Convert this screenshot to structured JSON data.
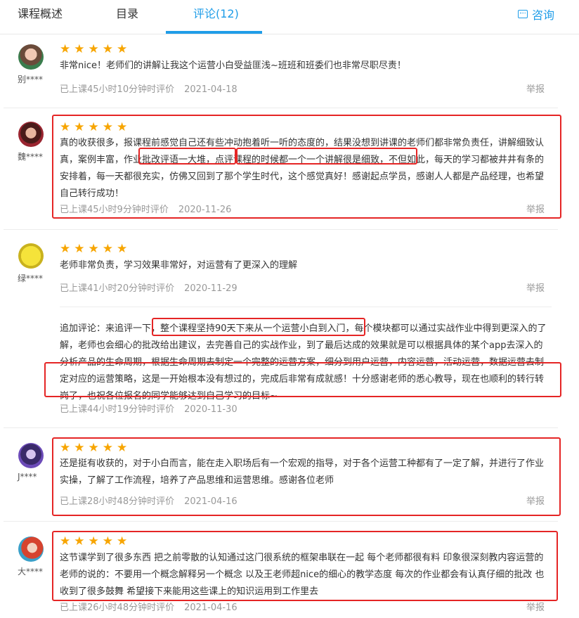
{
  "tabs": [
    {
      "label": "课程概述"
    },
    {
      "label": "目录"
    },
    {
      "label": "评论(12)"
    }
  ],
  "consult": "咨询",
  "report_label": "举报",
  "reviews": [
    {
      "user": "别****",
      "stars": "★★★★★",
      "text": "非常nice！老师们的讲解让我这个运营小白受益匪浅~班班和班委们也非常尽职尽责！",
      "attended": "已上课45小时10分钟时评价",
      "date": "2021-04-18"
    },
    {
      "user": "魏****",
      "stars": "★★★★★",
      "text": "真的收获很多，报课程前感觉自己还有些冲动抱着听一听的态度的，结果没想到讲课的老师们都非常负责任，讲解细致认真，案例丰富，作业批改评语一大堆，点评课程的时候都一个一个讲解很是细致，不但如此，每天的学习都被井井有条的安排着，每一天都很充实，仿佛又回到了那个学生时代，这个感觉真好！感谢起点学员，感谢人人都是产品经理，也希望自己转行成功！",
      "attended": "已上课45小时9分钟时评价",
      "date": "2020-11-26"
    },
    {
      "user": "绿****",
      "stars": "★★★★★",
      "text": "老师非常负责，学习效果非常好，对运营有了更深入的理解",
      "attended": "已上课41小时20分钟时评价",
      "date": "2020-11-29",
      "followup": "追加评论：来追评一下，整个课程坚持90天下来从一个运营小白到入门，每个模块都可以通过实战作业中得到更深入的了解，老师也会细心的批改给出建议，去完善自己的实战作业，到了最后达成的效果就是可以根据具体的某个app去深入的分析产品的生命周期，根据生命周期去制定一个完整的运营方案，细分到用户运营，内容运营，活动运营，数据运营去制定对应的运营策略，这是一开始根本没有想过的，完成后非常有成就感！十分感谢老师的悉心教导，现在也顺利的转行转岗了，也祝各位报名的同学能够达到自己学习的目标~",
      "followup_attended": "已上课44小时19分钟时评价",
      "followup_date": "2020-11-30"
    },
    {
      "user": "J****",
      "stars": "★★★★★",
      "text": "还是挺有收获的，对于小白而言，能在走入职场后有一个宏观的指导，对于各个运营工种都有了一定了解，并进行了作业实操，了解了工作流程，培养了产品思维和运营思维。感谢各位老师",
      "attended": "已上课28小时48分钟时评价",
      "date": "2021-04-16"
    },
    {
      "user": "大****",
      "stars": "★★★★★",
      "text": "这节课学到了很多东西 把之前零散的认知通过这门很系统的框架串联在一起 每个老师都很有料 印象很深刻教内容运营的老师的说的：不要用一个概念解释另一个概念 以及王老师超nice的细心的教学态度 每次的作业都会有认真仔细的批改 也收到了很多鼓舞 希望接下来能用这些课上的知识运用到工作里去",
      "attended": "已上课26小时48分钟时评价",
      "date": "2021-04-16"
    }
  ],
  "colors": {
    "accent": "#1f9de8",
    "star": "#f7a500",
    "highlight": "#e52525"
  }
}
